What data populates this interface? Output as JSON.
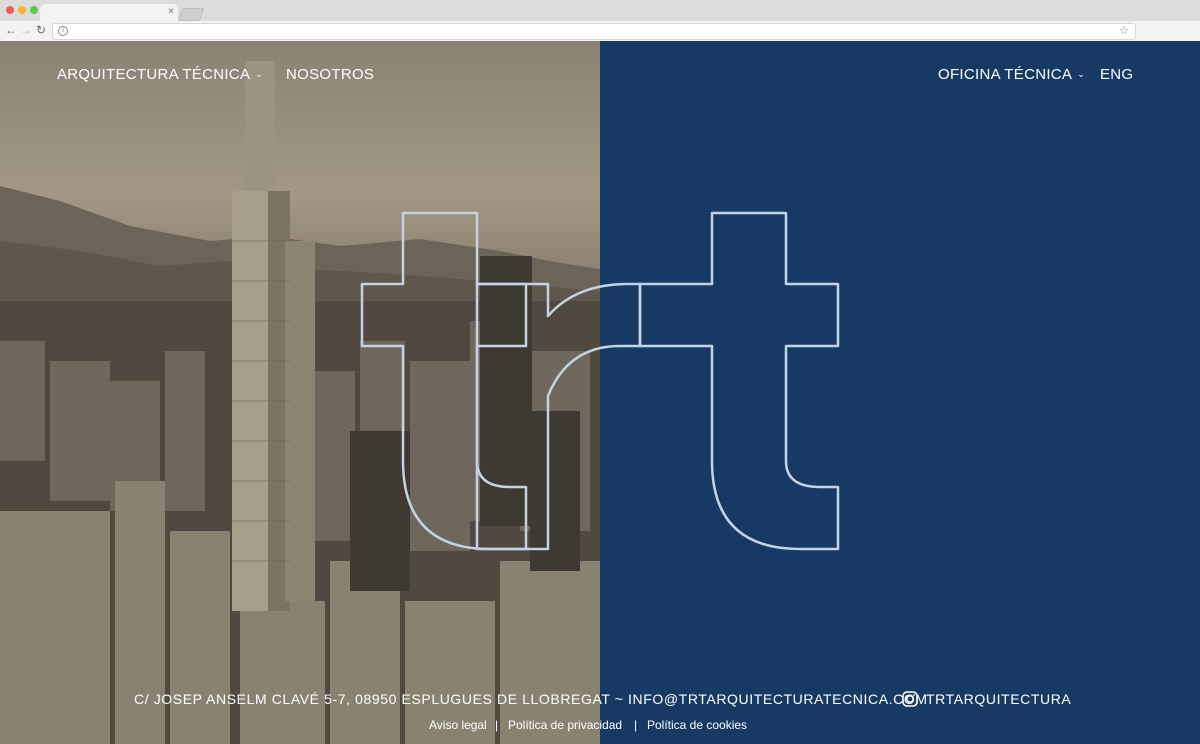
{
  "browser": {
    "tab_close": "×"
  },
  "nav": {
    "arquitectura": "ARQUITECTURA TÉCNICA",
    "nosotros": "NOSOTROS",
    "oficina": "OFICINA TÉCNICA",
    "lang": "ENG",
    "chevron": "⌄"
  },
  "footer": {
    "address": "C/ JOSEP ANSELM CLAVÉ 5-7, 08950 ESPLUGUES DE LLOBREGAT ~ INFO@TRTARQUITECTURATECNICA.COM",
    "instagram": "TRTARQUITECTURA",
    "links": [
      "Aviso legal",
      "Política de privacidad",
      "Política de cookies"
    ],
    "separator": "|"
  },
  "colors": {
    "panel": "#173a65",
    "outline": "#c3d2e4"
  },
  "icons": [
    "back-arrow-icon",
    "forward-arrow-icon",
    "reload-icon",
    "info-icon",
    "star-icon",
    "chevron-down-icon",
    "instagram-icon"
  ]
}
